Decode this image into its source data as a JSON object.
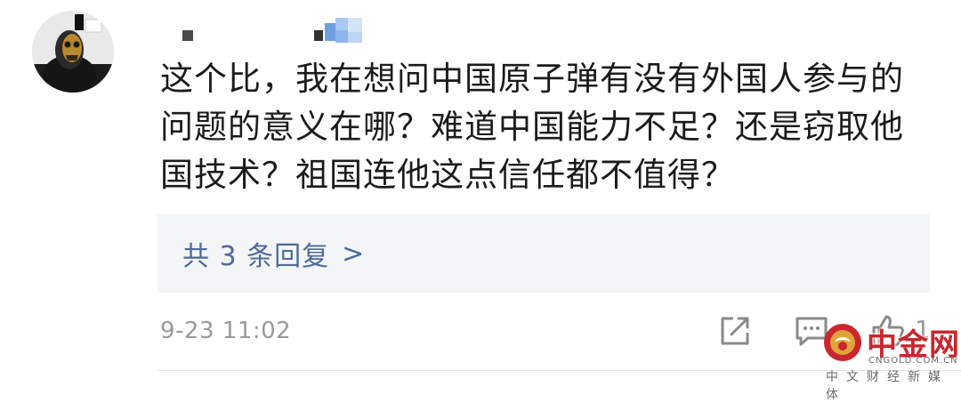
{
  "comment": {
    "text": "这个比，我在想问中国原子弹有没有外国人参与的问题的意义在哪？难道中国能力不足？还是窃取他国技术？祖国连他这点信任都不值得？",
    "timestamp": "9-23 11:02",
    "likes": "1"
  },
  "replies": {
    "label": "共 3 条回复",
    "chevron": ">"
  },
  "icons": {
    "share": "share-icon",
    "reply": "comment-icon",
    "like": "thumbs-up-icon"
  },
  "colors": {
    "link": "#4d6a9c",
    "reply_bg": "#f4f5f7",
    "meta_text": "#9a9a9a",
    "watermark_red": "#c9272d",
    "watermark_gold": "#e2a23a"
  },
  "watermark": {
    "title": "中金网",
    "url": "CNGOLD.COM.CN",
    "subtitle": "中文财经新媒体"
  }
}
